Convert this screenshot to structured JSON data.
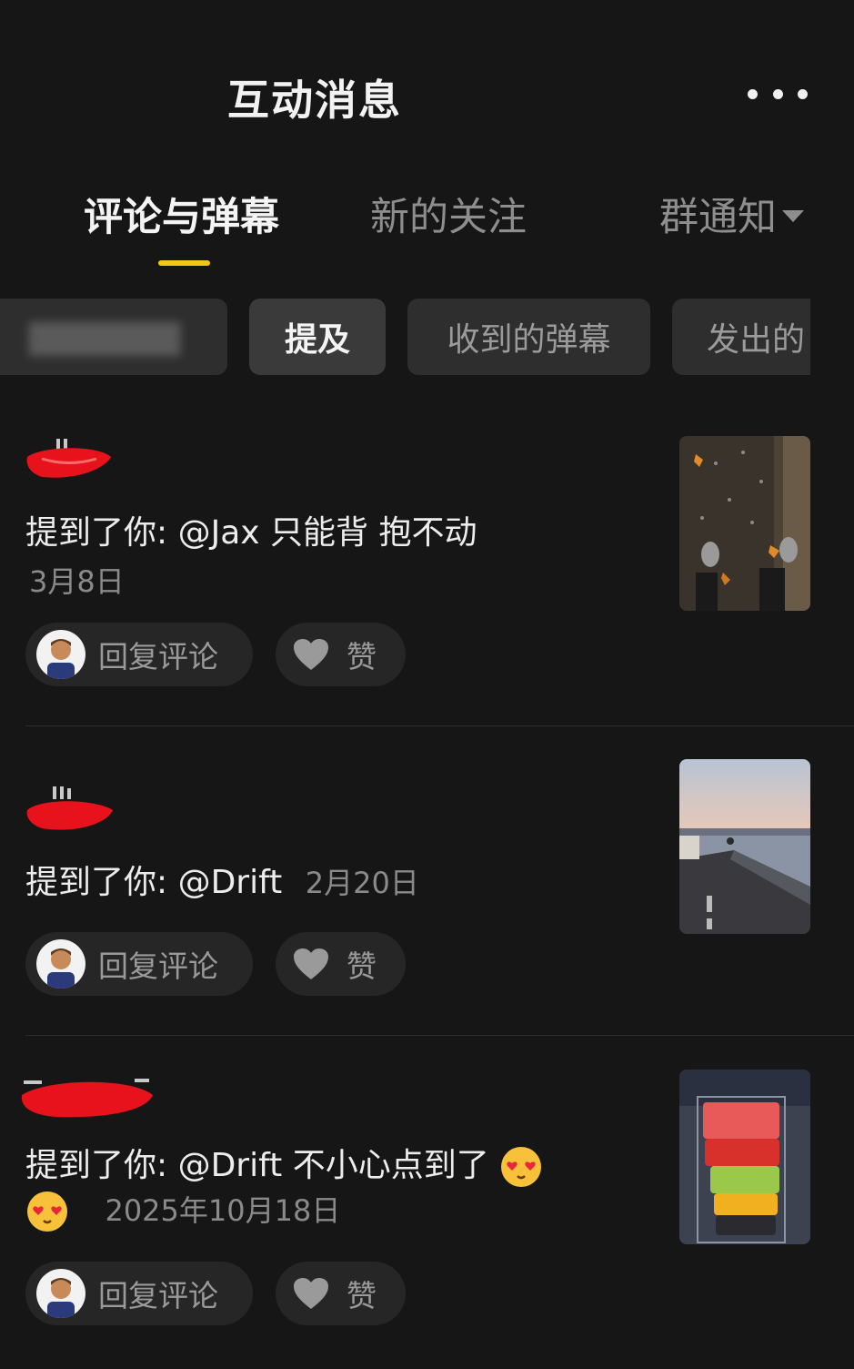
{
  "header": {
    "title": "互动消息"
  },
  "tabs": [
    {
      "label": "评论与弹幕",
      "active": true
    },
    {
      "label": "新的关注",
      "active": false
    },
    {
      "label": "群通知",
      "active": false
    }
  ],
  "filters": [
    {
      "label": "提及",
      "selected": true
    },
    {
      "label": "收到的弹幕",
      "selected": false
    },
    {
      "label": "发出的",
      "selected": false
    }
  ],
  "items": [
    {
      "text": "提到了你: @Jax 只能背 抱不动",
      "date": "3月8日",
      "reply_label": "回复评论",
      "like_label": "赞"
    },
    {
      "text": "提到了你: @Drift",
      "date": "2月20日",
      "reply_label": "回复评论",
      "like_label": "赞"
    },
    {
      "text": "提到了你: @Drift 不小心点到了",
      "date": "2025年10月18日",
      "reply_label": "回复评论",
      "like_label": "赞"
    }
  ],
  "colors": {
    "accent": "#f5c518",
    "background": "#161616",
    "redaction": "#e8121c"
  },
  "icons": {
    "more": "more-dots-icon",
    "heart": "heart-icon",
    "emoji": "heart-eyes-emoji-icon",
    "caret": "caret-down-icon"
  }
}
